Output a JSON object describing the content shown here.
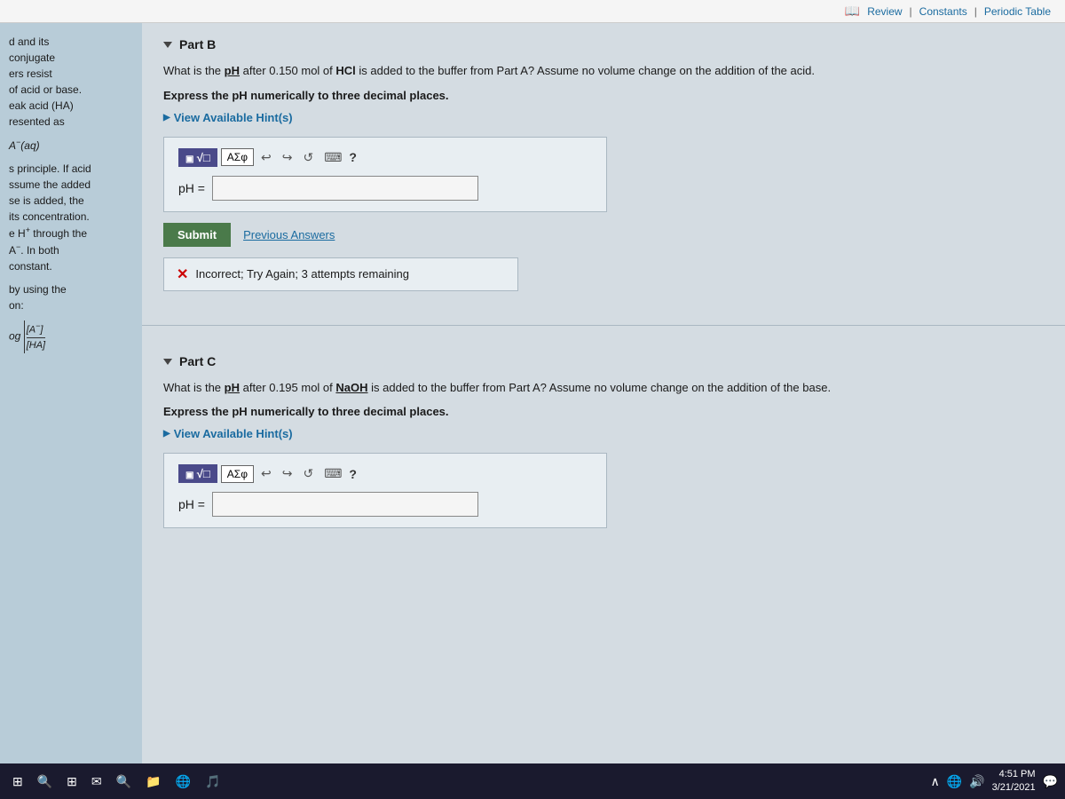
{
  "topbar": {
    "review_label": "Review",
    "constants_label": "Constants",
    "periodic_table_label": "Periodic Table"
  },
  "sidebar": {
    "text": "d and its conjugate ers resist of acid or base. eak acid (HA) resented as",
    "formula_A": "A⁻(aq)",
    "text2": "s principle. If acid ssume the added se is added, the its concentration. e H⁺ through the A⁻. In both constant.",
    "text3": "by using the on:",
    "formula_log": "og[A⁻]/[HA]"
  },
  "partB": {
    "label": "Part B",
    "question": "What is the pH after 0.150 mol of HCl is added to the buffer from Part A? Assume no volume change on the addition of the acid.",
    "express_instruction": "Express the pH numerically to three decimal places.",
    "hint_label": "View Available Hint(s)",
    "toolbar": {
      "sqrt_btn": "√",
      "symbol_btn": "ΑΣφ",
      "undo_icon": "↩",
      "redo_icon": "↪",
      "refresh_icon": "↺",
      "keyboard_icon": "⌨",
      "question_icon": "?"
    },
    "ph_label": "pH =",
    "ph_value": "",
    "submit_label": "Submit",
    "previous_answers_label": "Previous Answers",
    "error": {
      "icon": "✕",
      "message": "Incorrect; Try Again; 3 attempts remaining"
    }
  },
  "partC": {
    "label": "Part C",
    "question": "What is the pH after 0.195 mol of NaOH is added to the buffer from Part A? Assume no volume change on the addition of the base.",
    "express_instruction": "Express the pH numerically to three decimal places.",
    "hint_label": "View Available Hint(s)",
    "toolbar": {
      "sqrt_btn": "√",
      "symbol_btn": "ΑΣφ",
      "undo_icon": "↩",
      "redo_icon": "↪",
      "refresh_icon": "↺",
      "keyboard_icon": "⌨",
      "question_icon": "?"
    },
    "ph_label": "pH =",
    "ph_value": ""
  },
  "taskbar": {
    "clock_time": "4:51 PM",
    "clock_date": "3/21/2021"
  },
  "colors": {
    "accent_blue": "#1a6ba0",
    "submit_green": "#4a7a4a",
    "toolbar_purple": "#4a4a8a"
  }
}
